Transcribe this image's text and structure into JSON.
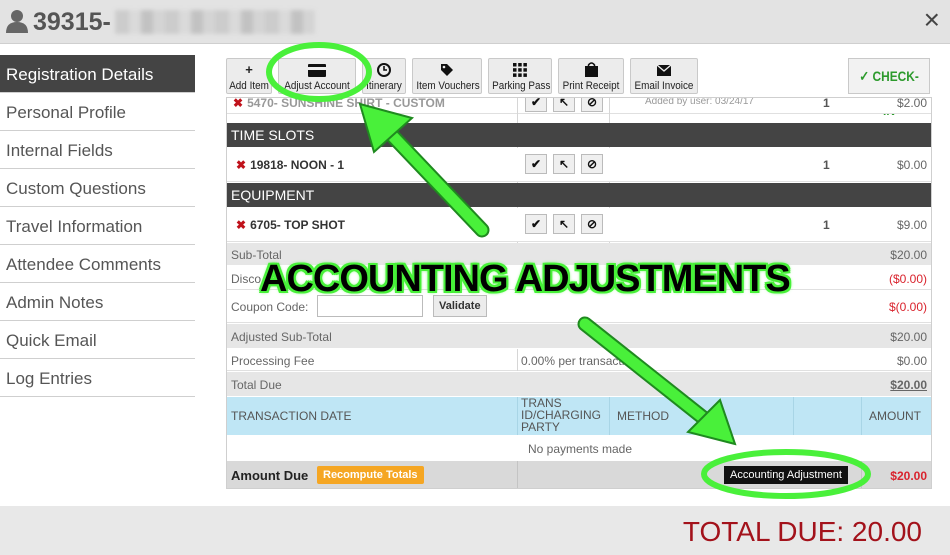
{
  "header": {
    "registration_id": "39315-",
    "close_glyph": "×"
  },
  "sidebar": {
    "items": [
      {
        "label": "Registration Details",
        "active": true
      },
      {
        "label": "Personal Profile"
      },
      {
        "label": "Internal Fields"
      },
      {
        "label": "Custom Questions"
      },
      {
        "label": "Travel Information"
      },
      {
        "label": "Attendee Comments"
      },
      {
        "label": "Admin Notes"
      },
      {
        "label": "Quick Email"
      },
      {
        "label": "Log Entries"
      }
    ]
  },
  "toolbar": {
    "buttons": [
      {
        "label": "Add Item",
        "icon": "plus-icon"
      },
      {
        "label": "Adjust Account",
        "icon": "credit-card-icon"
      },
      {
        "label": "Itinerary",
        "icon": "clock-icon"
      },
      {
        "label": "Item Vouchers",
        "icon": "tag-icon"
      },
      {
        "label": "Parking Pass",
        "icon": "grid-icon"
      },
      {
        "label": "Print Receipt",
        "icon": "shopping-bag-icon"
      },
      {
        "label": "Email Invoice",
        "icon": "envelope-icon"
      }
    ],
    "checkin_label": "✓ CHECK-IN"
  },
  "table": {
    "partial_row": {
      "name": "5470- SUNSHINE SHIRT - CUSTOM",
      "note": "Added by user: 03/24/17",
      "qty": "1",
      "amount": "$2.00"
    },
    "sections": [
      {
        "title": "TIME SLOTS",
        "item": {
          "name": "19818- NOON - 1",
          "qty": "1",
          "amount": "$0.00"
        }
      },
      {
        "title": "EQUIPMENT",
        "item": {
          "name": "6705- TOP SHOT",
          "qty": "1",
          "amount": "$9.00"
        }
      }
    ],
    "subtotal": {
      "label": "Sub-Total",
      "value": "$20.00"
    },
    "discount": {
      "label": "Disco",
      "value": "($0.00)"
    },
    "coupon": {
      "label": "Coupon Code:",
      "validate_label": "Validate",
      "value": "$(0.00)"
    },
    "adjusted_subtotal": {
      "label": "Adjusted Sub-Total",
      "value": "$20.00"
    },
    "processing_fee": {
      "label": "Processing Fee",
      "rate": "0.00%   per transaction",
      "value": "$0.00"
    },
    "total_due": {
      "label": "Total Due",
      "value": "$20.00"
    },
    "transactions": {
      "headers": [
        "TRANSACTION DATE",
        "TRANS ID/CHARGING PARTY",
        "METHOD",
        "AMOUNT"
      ],
      "empty_message": "No payments made"
    },
    "amount_due": {
      "label": "Amount Due",
      "recompute_label": "Recompute Totals",
      "adjust_label": "Accounting Adjustment",
      "value": "$20.00"
    }
  },
  "footer": {
    "total_due": "TOTAL DUE: 20.00"
  },
  "annotation": {
    "label": "ACCOUNTING ADJUSTMENTS",
    "highlight_color": "#49f03a"
  }
}
